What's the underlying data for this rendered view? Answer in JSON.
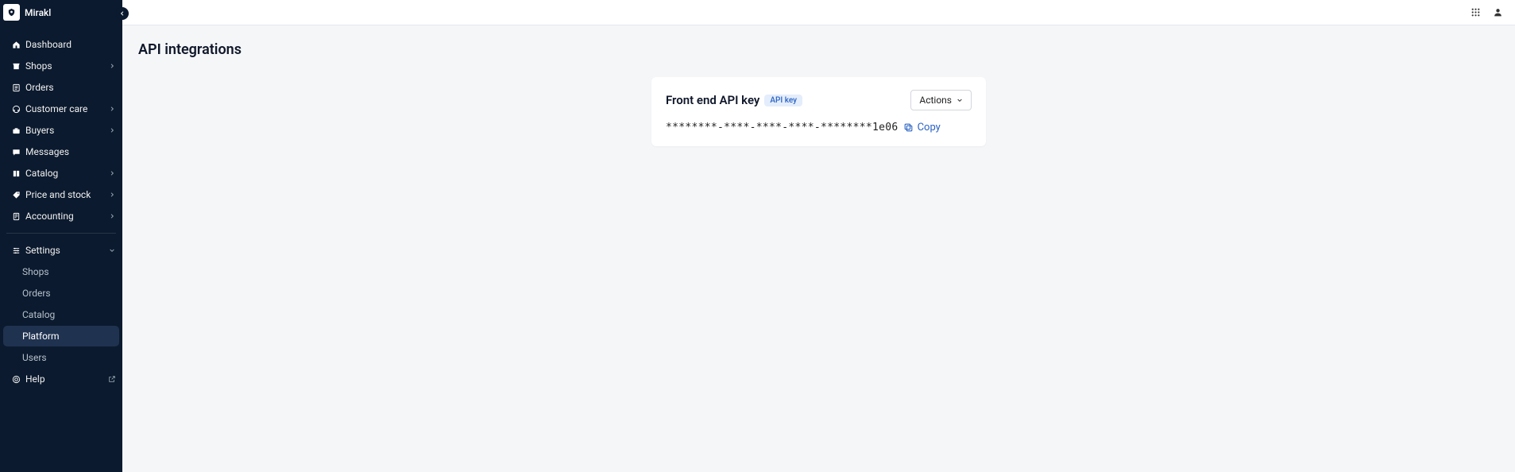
{
  "brand": "Mirakl",
  "sidebar": {
    "items": [
      {
        "label": "Dashboard",
        "expandable": false,
        "icon": "home-icon"
      },
      {
        "label": "Shops",
        "expandable": true,
        "icon": "shop-icon"
      },
      {
        "label": "Orders",
        "expandable": false,
        "icon": "orders-icon"
      },
      {
        "label": "Customer care",
        "expandable": true,
        "icon": "customer-care-icon"
      },
      {
        "label": "Buyers",
        "expandable": true,
        "icon": "buyers-icon"
      },
      {
        "label": "Messages",
        "expandable": false,
        "icon": "messages-icon"
      },
      {
        "label": "Catalog",
        "expandable": true,
        "icon": "catalog-icon"
      },
      {
        "label": "Price and stock",
        "expandable": true,
        "icon": "price-icon"
      },
      {
        "label": "Accounting",
        "expandable": true,
        "icon": "accounting-icon"
      }
    ],
    "settings": {
      "label": "Settings",
      "sub": [
        {
          "label": "Shops",
          "active": false
        },
        {
          "label": "Orders",
          "active": false
        },
        {
          "label": "Catalog",
          "active": false
        },
        {
          "label": "Platform",
          "active": true
        },
        {
          "label": "Users",
          "active": false
        }
      ]
    },
    "help": {
      "label": "Help"
    }
  },
  "page": {
    "title": "API integrations",
    "card": {
      "title": "Front end API key",
      "badge": "API key",
      "actions_label": "Actions",
      "api_key": "********-****-****-****-********1e06",
      "copy_label": "Copy"
    }
  },
  "colors": {
    "sidebar_bg": "#0b1a2e",
    "link": "#2a63c4",
    "badge_bg": "#e4edfb"
  }
}
